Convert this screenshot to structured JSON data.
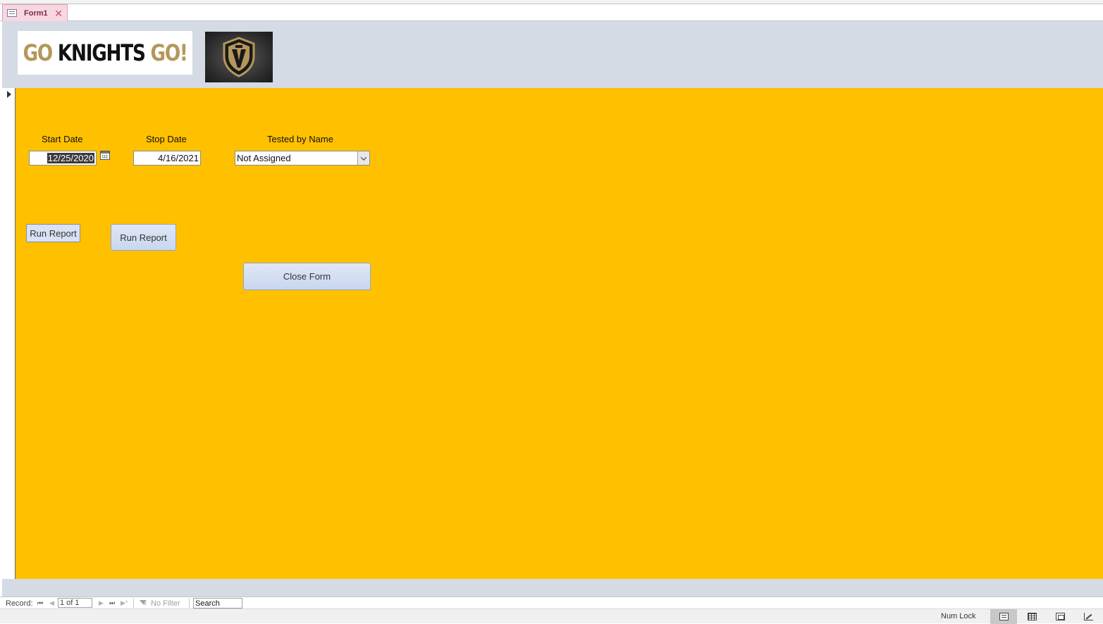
{
  "document_tab": {
    "label": "Form1",
    "icon": "form-icon",
    "close_icon": "close-icon"
  },
  "header": {
    "logo_text": {
      "part1": "GO",
      "part2": "KNIGHTS",
      "part3": "GO!"
    },
    "logo_image": "golden-knights-helmet-shield"
  },
  "form": {
    "start_date": {
      "label": "Start Date",
      "value": "12/25/2020"
    },
    "stop_date": {
      "label": "Stop Date",
      "value": "4/16/2021"
    },
    "tested_by": {
      "label": "Tested by Name",
      "value": "Not Assigned"
    },
    "buttons": {
      "run_report_1": "Run Report",
      "run_report_2": "Run Report",
      "close_form": "Close Form"
    },
    "colors": {
      "detail_bg": "#ffc000",
      "header_bg": "#d5dbe5"
    }
  },
  "navigation": {
    "record_label": "Record:",
    "record_position": "1 of 1",
    "filter_label": "No Filter",
    "search_placeholder": "Search"
  },
  "status": {
    "num_lock": "Num Lock"
  }
}
